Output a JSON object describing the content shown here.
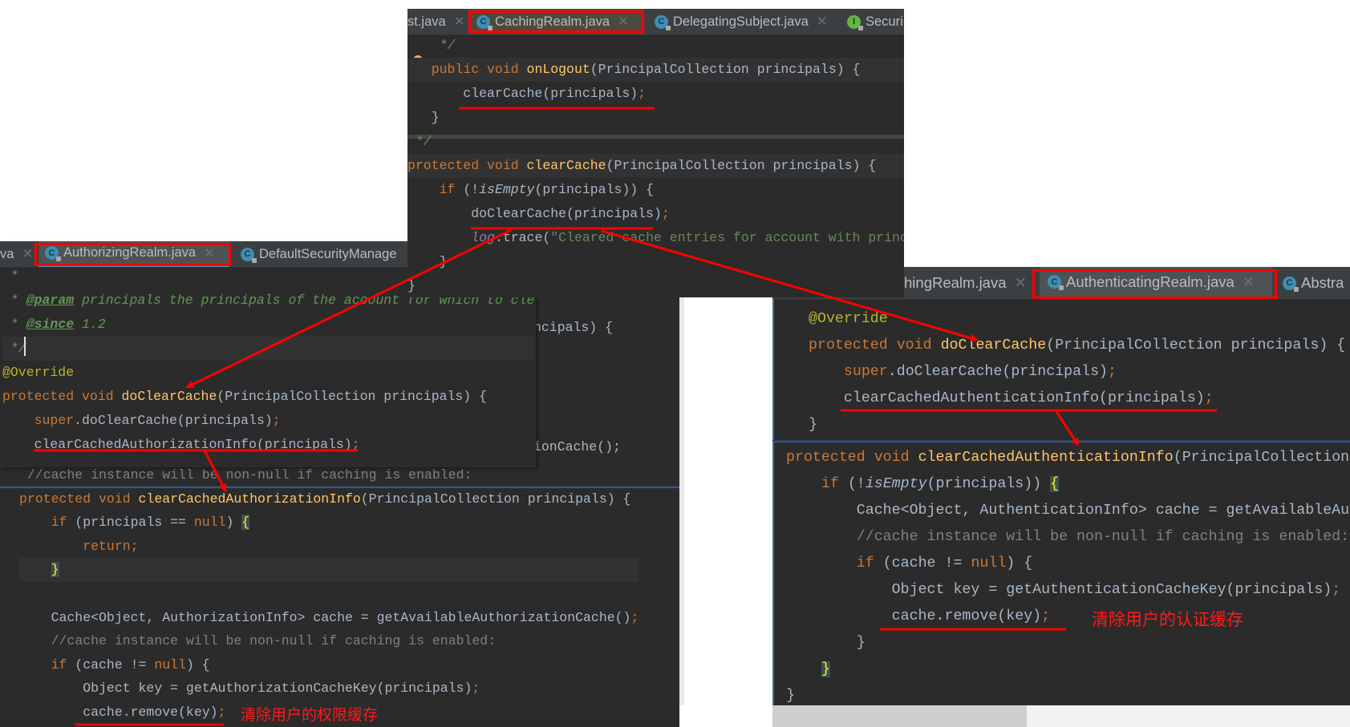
{
  "mid": {
    "tabs": [
      {
        "label": "st.java",
        "icon": "none"
      },
      {
        "label": "CachingRealm.java",
        "icon": "class-icon"
      },
      {
        "label": "DelegatingSubject.java",
        "icon": "class-icon"
      },
      {
        "label": "Securi",
        "icon": "interface-icon"
      }
    ],
    "lines": [
      [
        [
          "t",
          "    "
        ],
        [
          "d",
          "*/"
        ]
      ],
      [
        [
          "t",
          "   "
        ],
        [
          "k",
          "public void "
        ],
        [
          "m",
          "onLogout"
        ],
        [
          "t",
          "(PrincipalCollection principals) {"
        ]
      ],
      [
        [
          "t",
          "       clearCache(principals)"
        ],
        [
          "k",
          ";"
        ]
      ],
      [
        [
          "t",
          "   }"
        ]
      ],
      [
        [
          "t",
          " "
        ],
        [
          "d",
          "*/"
        ]
      ],
      [
        [
          "k",
          "protected void "
        ],
        [
          "m",
          "clearCache"
        ],
        [
          "t",
          "(PrincipalCollection principals) {"
        ]
      ],
      [
        [
          "t",
          "    "
        ],
        [
          "k",
          "if "
        ],
        [
          "t",
          "(!"
        ],
        [
          "i",
          "isEmpty"
        ],
        [
          "t",
          "(principals)) {"
        ]
      ],
      [
        [
          "t",
          "        doClearCache(principals)"
        ],
        [
          "k",
          ";"
        ]
      ],
      [
        [
          "t",
          "        "
        ],
        [
          "p",
          "log"
        ],
        [
          "t",
          ".trace("
        ],
        [
          "s",
          "\"Cleared cache entries for account with princ"
        ]
      ],
      [
        [
          "t",
          "    }"
        ]
      ],
      [
        [
          "t",
          "}"
        ]
      ]
    ]
  },
  "left_top": {
    "tabs": [
      {
        "label": "va",
        "icon": "none"
      },
      {
        "label": "AuthorizingRealm.java",
        "icon": "class-icon"
      },
      {
        "label": "DefaultSecurityManage",
        "icon": "class-icon"
      }
    ],
    "lines": [
      [
        [
          "d",
          " *"
        ]
      ],
      [
        [
          "d",
          " * "
        ],
        [
          "dt",
          "@param"
        ],
        [
          "d",
          " principals the principals of the account for which to cle"
        ]
      ],
      [
        [
          "d",
          " * "
        ],
        [
          "dt",
          "@since"
        ],
        [
          "d",
          " 1.2"
        ]
      ],
      [
        [
          "d",
          " */"
        ]
      ],
      [
        [
          "a",
          "@Override"
        ]
      ],
      [
        [
          "k",
          "protected void "
        ],
        [
          "m",
          "doClearCache"
        ],
        [
          "t",
          "(PrincipalCollection principals) {"
        ]
      ],
      [
        [
          "t",
          "    "
        ],
        [
          "k",
          "super"
        ],
        [
          "t",
          ".doClearCache(principals)"
        ],
        [
          "k",
          ";"
        ]
      ],
      [
        [
          "t",
          "    clearCachedAuthorizationInfo(principals)"
        ],
        [
          "k",
          ";"
        ]
      ]
    ]
  },
  "left_bottom": {
    "partial_lines": [
      "ncipals) {",
      "ionCache();"
    ],
    "lines": [
      [
        [
          "c",
          " //cache instance will be non-null if caching is enabled:"
        ]
      ],
      [
        [
          "k",
          "protected void "
        ],
        [
          "m",
          "clearCachedAuthorizationInfo"
        ],
        [
          "t",
          "(PrincipalCollection principals) {"
        ]
      ],
      [
        [
          "t",
          "    "
        ],
        [
          "k",
          "if "
        ],
        [
          "t",
          "(principals == "
        ],
        [
          "k",
          "null"
        ],
        [
          "t",
          ") "
        ],
        [
          "y",
          "{"
        ]
      ],
      [
        [
          "t",
          "        "
        ],
        [
          "k",
          "return;"
        ]
      ],
      [
        [
          "t",
          "    "
        ],
        [
          "y",
          "}"
        ]
      ],
      [
        [
          "t",
          ""
        ]
      ],
      [
        [
          "t",
          "    Cache<Object, AuthorizationInfo> cache = getAvailableAuthorizationCache()"
        ],
        [
          "k",
          ";"
        ]
      ],
      [
        [
          "t",
          "    "
        ],
        [
          "c",
          "//cache instance will be non-null if caching is enabled:"
        ]
      ],
      [
        [
          "t",
          "    "
        ],
        [
          "k",
          "if "
        ],
        [
          "t",
          "(cache != "
        ],
        [
          "k",
          "null"
        ],
        [
          "t",
          ") {"
        ]
      ],
      [
        [
          "t",
          "        Object key = getAuthorizationCacheKey(principals)"
        ],
        [
          "k",
          ";"
        ]
      ],
      [
        [
          "t",
          "        cache.remove(key)"
        ],
        [
          "k",
          ";"
        ]
      ]
    ]
  },
  "right": {
    "tabs": [
      {
        "label": "hingRealm.java",
        "icon": "none"
      },
      {
        "label": "AuthenticatingRealm.java",
        "icon": "class-icon"
      },
      {
        "label": "Abstra",
        "icon": "class-icon"
      }
    ],
    "section1": [
      [
        [
          "a",
          "@Override"
        ]
      ],
      [
        [
          "k",
          "protected void "
        ],
        [
          "m",
          "doClearCache"
        ],
        [
          "t",
          "(PrincipalCollection principals) {"
        ]
      ],
      [
        [
          "t",
          "    "
        ],
        [
          "k",
          "super"
        ],
        [
          "t",
          ".doClearCache(principals)"
        ],
        [
          "k",
          ";"
        ]
      ],
      [
        [
          "t",
          "    clearCachedAuthenticationInfo(principals)"
        ],
        [
          "k",
          ";"
        ]
      ],
      [
        [
          "t",
          "}"
        ]
      ]
    ],
    "section2": [
      [
        [
          "k",
          "protected void "
        ],
        [
          "m",
          "clearCachedAuthenticationInfo"
        ],
        [
          "t",
          "(PrincipalCollection"
        ]
      ],
      [
        [
          "t",
          "    "
        ],
        [
          "k",
          "if "
        ],
        [
          "t",
          "(!"
        ],
        [
          "i",
          "isEmpty"
        ],
        [
          "t",
          "(principals)) "
        ],
        [
          "y",
          "{"
        ]
      ],
      [
        [
          "t",
          "        Cache<Object, AuthenticationInfo> cache = getAvailableAu"
        ]
      ],
      [
        [
          "t",
          "        "
        ],
        [
          "c",
          "//cache instance will be non-null if caching is enabled:"
        ]
      ],
      [
        [
          "t",
          "        "
        ],
        [
          "k",
          "if "
        ],
        [
          "t",
          "(cache != "
        ],
        [
          "k",
          "null"
        ],
        [
          "t",
          ") {"
        ]
      ],
      [
        [
          "t",
          "            Object key = getAuthenticationCacheKey(principals)"
        ],
        [
          "k",
          ";"
        ]
      ],
      [
        [
          "t",
          "            cache.remove(key)"
        ],
        [
          "k",
          ";"
        ]
      ],
      [
        [
          "t",
          "        }"
        ]
      ],
      [
        [
          "t",
          "    "
        ],
        [
          "y",
          "}"
        ]
      ],
      [
        [
          "t",
          "}"
        ]
      ]
    ]
  },
  "annotations": {
    "authorization_note": "清除用户的权限缓存",
    "authentication_note": "清除用户的认证缓存"
  },
  "colors": {
    "annotation": "#ff0000",
    "editor_bg": "#2b2b2b",
    "keyword": "#cc7832",
    "method": "#ffc66d"
  }
}
